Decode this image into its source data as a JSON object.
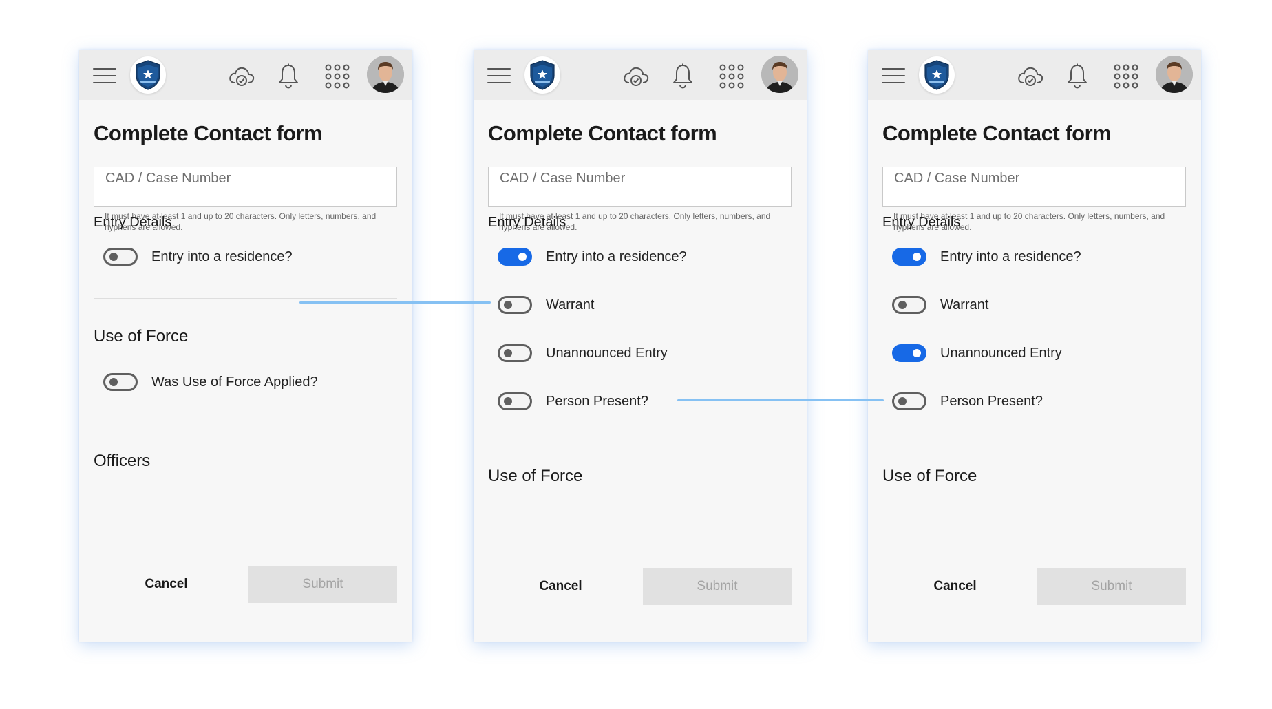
{
  "form": {
    "title": "Complete Contact form",
    "case_placeholder": "CAD / Case Number",
    "case_helper": "It must have at least 1 and up to 20 characters. Only letters, numbers, and hyphens are allowed.",
    "cancel_label": "Cancel",
    "submit_label": "Submit"
  },
  "sections": {
    "entry_details": "Entry Details",
    "use_of_force": "Use of Force",
    "officers": "Officers"
  },
  "toggles": {
    "entry_residence": "Entry into a residence?",
    "warrant": "Warrant",
    "unannounced_entry": "Unannounced Entry",
    "person_present": "Person Present?",
    "use_of_force_applied": "Was Use of Force Applied?"
  },
  "screens": [
    {
      "states": {
        "entry_residence": false,
        "use_of_force_applied": false
      }
    },
    {
      "states": {
        "entry_residence": true,
        "warrant": false,
        "unannounced_entry": false,
        "person_present": false
      }
    },
    {
      "states": {
        "entry_residence": true,
        "warrant": false,
        "unannounced_entry": true,
        "person_present": false
      }
    }
  ],
  "icons": {
    "menu": "hamburger-menu-icon",
    "logo": "police-badge-logo",
    "sync": "cloud-check-icon",
    "notifications": "bell-icon",
    "apps": "apps-grid-icon",
    "profile": "avatar"
  },
  "colors": {
    "accent": "#1769e6",
    "toggle_off": "#5f5f5f",
    "connector": "#86c1f3",
    "panel_bg": "#f7f7f7",
    "topbar_bg": "#ececec",
    "submit_disabled_bg": "#e1e1e1"
  }
}
